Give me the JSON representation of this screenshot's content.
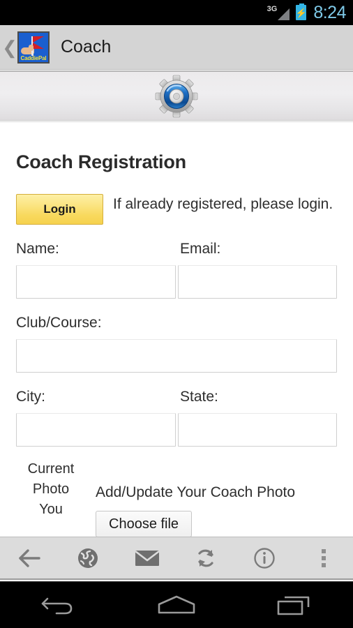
{
  "status_bar": {
    "network_label": "3G",
    "time": "8:24",
    "battery_icon": "battery-charging-icon",
    "signal_icon": "signal-bars-icon",
    "time_color": "#7ec9e8",
    "battery_color": "#33b5e5"
  },
  "action_bar": {
    "up_icon": "back-chevron-icon",
    "app_icon": "caddiepal-app-icon",
    "app_icon_brand": "CaddiePal",
    "title": "Coach",
    "background_color": "#d4d4d4"
  },
  "gear_header": {
    "icon": "gear-settings-icon",
    "gear_body_color": "#b8b8b8",
    "gear_ring_color": "#1f6fc4"
  },
  "page": {
    "heading": "Coach Registration",
    "login": {
      "button_label": "Login",
      "note": "If already registered, please login.",
      "button_color": "#f8d95e"
    },
    "fields": [
      {
        "label": "Name:",
        "value": "",
        "placeholder": "",
        "name": "name"
      },
      {
        "label": "Email:",
        "value": "",
        "placeholder": "",
        "name": "email"
      },
      {
        "label": "Club/Course:",
        "value": "",
        "placeholder": "",
        "name": "club-course"
      },
      {
        "label": "City:",
        "value": "",
        "placeholder": "",
        "name": "city"
      },
      {
        "label": "State:",
        "value": "",
        "placeholder": "",
        "name": "state"
      }
    ],
    "photo": {
      "current_photo_line1": "Current",
      "current_photo_line2": "Photo",
      "current_photo_line3": "You",
      "upload_title": "Add/Update Your Coach Photo",
      "choose_file_label": "Choose file"
    }
  },
  "bottom_toolbar": {
    "items": [
      {
        "icon": "back-arrow-icon"
      },
      {
        "icon": "globe-icon"
      },
      {
        "icon": "envelope-icon"
      },
      {
        "icon": "refresh-icon"
      },
      {
        "icon": "info-icon"
      },
      {
        "icon": "overflow-menu-icon"
      }
    ],
    "background_color": "#dcdcdc"
  },
  "nav_bar": {
    "items": [
      {
        "icon": "nav-back-icon"
      },
      {
        "icon": "nav-home-icon"
      },
      {
        "icon": "nav-recents-icon"
      }
    ],
    "background_color": "#000000"
  }
}
